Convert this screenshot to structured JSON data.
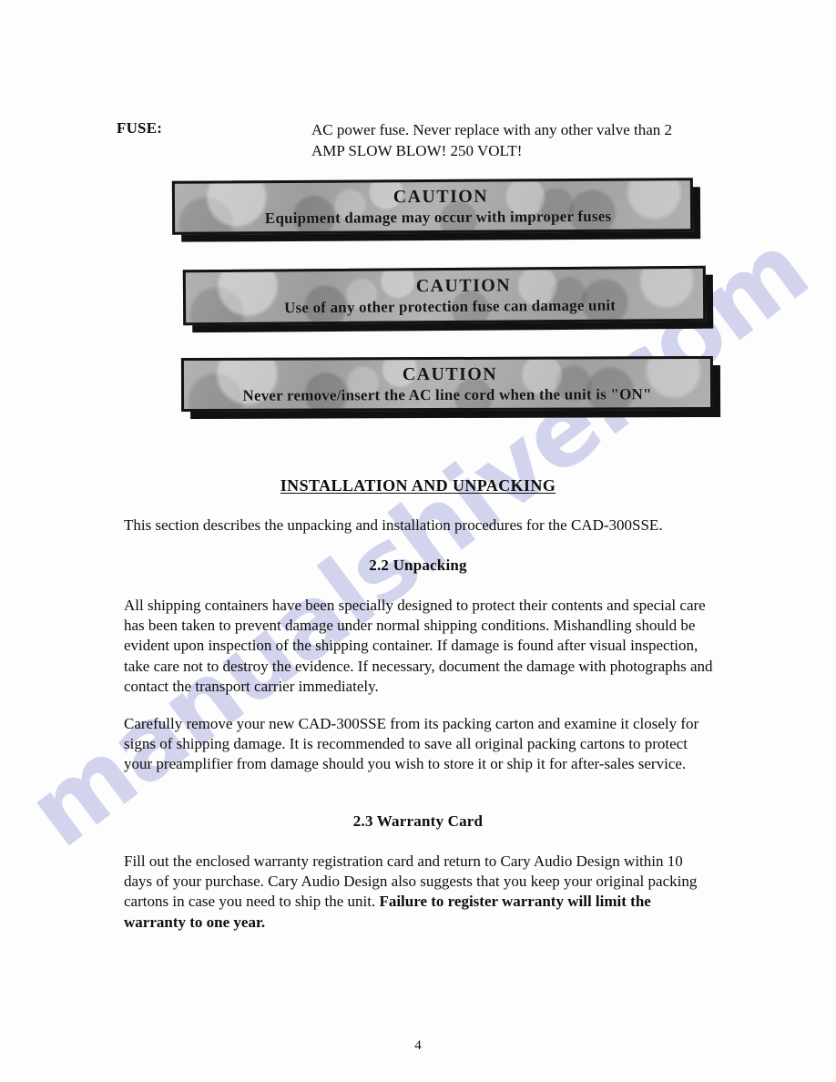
{
  "document": {
    "page_number": "4",
    "watermark": "manualshive.com",
    "watermark_color": "#b9bbe4"
  },
  "fuse": {
    "label": "FUSE:",
    "description": "AC power fuse.  Never replace with any other valve than 2 AMP SLOW BLOW! 250 VOLT!"
  },
  "cautions": [
    {
      "title": "CAUTION",
      "message": "Equipment damage may occur with  improper fuses"
    },
    {
      "title": "CAUTION",
      "message": "Use of any other protection fuse can damage unit"
    },
    {
      "title": "CAUTION",
      "message": "Never remove/insert the AC line cord when the unit is \"ON\""
    }
  ],
  "sections": {
    "installation_heading": "INSTALLATION AND UNPACKING",
    "intro_paragraph": "This section describes the unpacking and installation procedures for the CAD-300SSE.",
    "unpacking_heading": "2.2 Unpacking",
    "unpacking_paragraph_1": "All shipping containers have been specially designed to protect their contents and special care has been taken to prevent damage under normal shipping conditions.  Mishandling should be evident upon inspection of the shipping container.  If damage is found after visual inspection, take care not to destroy the evidence.  If necessary, document the damage with photographs and contact the transport carrier immediately.",
    "unpacking_paragraph_2": "Carefully remove your new CAD-300SSE from its packing carton and examine it closely for signs of shipping damage.  It is recommended to save all original packing cartons to protect your preamplifier from damage should you wish to store it or ship it for after-sales service.",
    "warranty_heading": "2.3 Warranty Card",
    "warranty_paragraph_normal": "Fill out the enclosed warranty registration card and return to Cary Audio Design within 10 days of your purchase.  Cary Audio Design also suggests that you keep your original packing cartons in case you need to ship the unit.  ",
    "warranty_paragraph_bold": "Failure to register warranty will limit the warranty to one year."
  }
}
